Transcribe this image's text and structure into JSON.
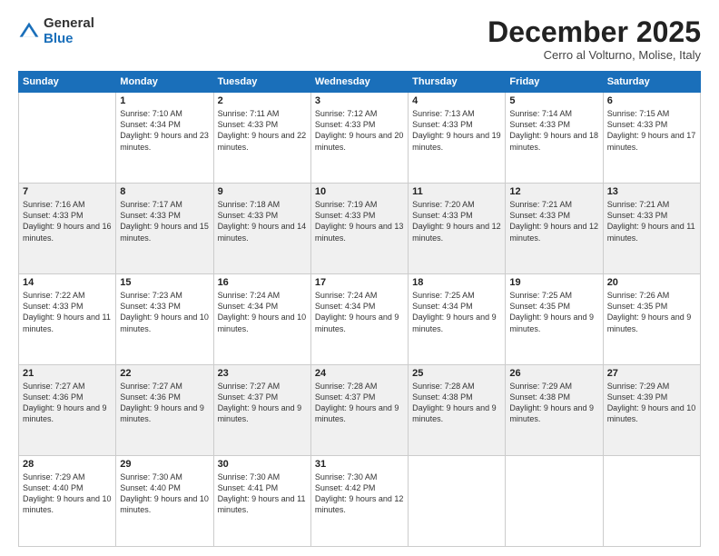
{
  "logo": {
    "general": "General",
    "blue": "Blue"
  },
  "title": "December 2025",
  "location": "Cerro al Volturno, Molise, Italy",
  "weekdays": [
    "Sunday",
    "Monday",
    "Tuesday",
    "Wednesday",
    "Thursday",
    "Friday",
    "Saturday"
  ],
  "weeks": [
    [
      {
        "day": "",
        "sunrise": "",
        "sunset": "",
        "daylight": ""
      },
      {
        "day": "1",
        "sunrise": "Sunrise: 7:10 AM",
        "sunset": "Sunset: 4:34 PM",
        "daylight": "Daylight: 9 hours and 23 minutes."
      },
      {
        "day": "2",
        "sunrise": "Sunrise: 7:11 AM",
        "sunset": "Sunset: 4:33 PM",
        "daylight": "Daylight: 9 hours and 22 minutes."
      },
      {
        "day": "3",
        "sunrise": "Sunrise: 7:12 AM",
        "sunset": "Sunset: 4:33 PM",
        "daylight": "Daylight: 9 hours and 20 minutes."
      },
      {
        "day": "4",
        "sunrise": "Sunrise: 7:13 AM",
        "sunset": "Sunset: 4:33 PM",
        "daylight": "Daylight: 9 hours and 19 minutes."
      },
      {
        "day": "5",
        "sunrise": "Sunrise: 7:14 AM",
        "sunset": "Sunset: 4:33 PM",
        "daylight": "Daylight: 9 hours and 18 minutes."
      },
      {
        "day": "6",
        "sunrise": "Sunrise: 7:15 AM",
        "sunset": "Sunset: 4:33 PM",
        "daylight": "Daylight: 9 hours and 17 minutes."
      }
    ],
    [
      {
        "day": "7",
        "sunrise": "Sunrise: 7:16 AM",
        "sunset": "Sunset: 4:33 PM",
        "daylight": "Daylight: 9 hours and 16 minutes."
      },
      {
        "day": "8",
        "sunrise": "Sunrise: 7:17 AM",
        "sunset": "Sunset: 4:33 PM",
        "daylight": "Daylight: 9 hours and 15 minutes."
      },
      {
        "day": "9",
        "sunrise": "Sunrise: 7:18 AM",
        "sunset": "Sunset: 4:33 PM",
        "daylight": "Daylight: 9 hours and 14 minutes."
      },
      {
        "day": "10",
        "sunrise": "Sunrise: 7:19 AM",
        "sunset": "Sunset: 4:33 PM",
        "daylight": "Daylight: 9 hours and 13 minutes."
      },
      {
        "day": "11",
        "sunrise": "Sunrise: 7:20 AM",
        "sunset": "Sunset: 4:33 PM",
        "daylight": "Daylight: 9 hours and 12 minutes."
      },
      {
        "day": "12",
        "sunrise": "Sunrise: 7:21 AM",
        "sunset": "Sunset: 4:33 PM",
        "daylight": "Daylight: 9 hours and 12 minutes."
      },
      {
        "day": "13",
        "sunrise": "Sunrise: 7:21 AM",
        "sunset": "Sunset: 4:33 PM",
        "daylight": "Daylight: 9 hours and 11 minutes."
      }
    ],
    [
      {
        "day": "14",
        "sunrise": "Sunrise: 7:22 AM",
        "sunset": "Sunset: 4:33 PM",
        "daylight": "Daylight: 9 hours and 11 minutes."
      },
      {
        "day": "15",
        "sunrise": "Sunrise: 7:23 AM",
        "sunset": "Sunset: 4:33 PM",
        "daylight": "Daylight: 9 hours and 10 minutes."
      },
      {
        "day": "16",
        "sunrise": "Sunrise: 7:24 AM",
        "sunset": "Sunset: 4:34 PM",
        "daylight": "Daylight: 9 hours and 10 minutes."
      },
      {
        "day": "17",
        "sunrise": "Sunrise: 7:24 AM",
        "sunset": "Sunset: 4:34 PM",
        "daylight": "Daylight: 9 hours and 9 minutes."
      },
      {
        "day": "18",
        "sunrise": "Sunrise: 7:25 AM",
        "sunset": "Sunset: 4:34 PM",
        "daylight": "Daylight: 9 hours and 9 minutes."
      },
      {
        "day": "19",
        "sunrise": "Sunrise: 7:25 AM",
        "sunset": "Sunset: 4:35 PM",
        "daylight": "Daylight: 9 hours and 9 minutes."
      },
      {
        "day": "20",
        "sunrise": "Sunrise: 7:26 AM",
        "sunset": "Sunset: 4:35 PM",
        "daylight": "Daylight: 9 hours and 9 minutes."
      }
    ],
    [
      {
        "day": "21",
        "sunrise": "Sunrise: 7:27 AM",
        "sunset": "Sunset: 4:36 PM",
        "daylight": "Daylight: 9 hours and 9 minutes."
      },
      {
        "day": "22",
        "sunrise": "Sunrise: 7:27 AM",
        "sunset": "Sunset: 4:36 PM",
        "daylight": "Daylight: 9 hours and 9 minutes."
      },
      {
        "day": "23",
        "sunrise": "Sunrise: 7:27 AM",
        "sunset": "Sunset: 4:37 PM",
        "daylight": "Daylight: 9 hours and 9 minutes."
      },
      {
        "day": "24",
        "sunrise": "Sunrise: 7:28 AM",
        "sunset": "Sunset: 4:37 PM",
        "daylight": "Daylight: 9 hours and 9 minutes."
      },
      {
        "day": "25",
        "sunrise": "Sunrise: 7:28 AM",
        "sunset": "Sunset: 4:38 PM",
        "daylight": "Daylight: 9 hours and 9 minutes."
      },
      {
        "day": "26",
        "sunrise": "Sunrise: 7:29 AM",
        "sunset": "Sunset: 4:38 PM",
        "daylight": "Daylight: 9 hours and 9 minutes."
      },
      {
        "day": "27",
        "sunrise": "Sunrise: 7:29 AM",
        "sunset": "Sunset: 4:39 PM",
        "daylight": "Daylight: 9 hours and 10 minutes."
      }
    ],
    [
      {
        "day": "28",
        "sunrise": "Sunrise: 7:29 AM",
        "sunset": "Sunset: 4:40 PM",
        "daylight": "Daylight: 9 hours and 10 minutes."
      },
      {
        "day": "29",
        "sunrise": "Sunrise: 7:30 AM",
        "sunset": "Sunset: 4:40 PM",
        "daylight": "Daylight: 9 hours and 10 minutes."
      },
      {
        "day": "30",
        "sunrise": "Sunrise: 7:30 AM",
        "sunset": "Sunset: 4:41 PM",
        "daylight": "Daylight: 9 hours and 11 minutes."
      },
      {
        "day": "31",
        "sunrise": "Sunrise: 7:30 AM",
        "sunset": "Sunset: 4:42 PM",
        "daylight": "Daylight: 9 hours and 12 minutes."
      },
      {
        "day": "",
        "sunrise": "",
        "sunset": "",
        "daylight": ""
      },
      {
        "day": "",
        "sunrise": "",
        "sunset": "",
        "daylight": ""
      },
      {
        "day": "",
        "sunrise": "",
        "sunset": "",
        "daylight": ""
      }
    ]
  ]
}
